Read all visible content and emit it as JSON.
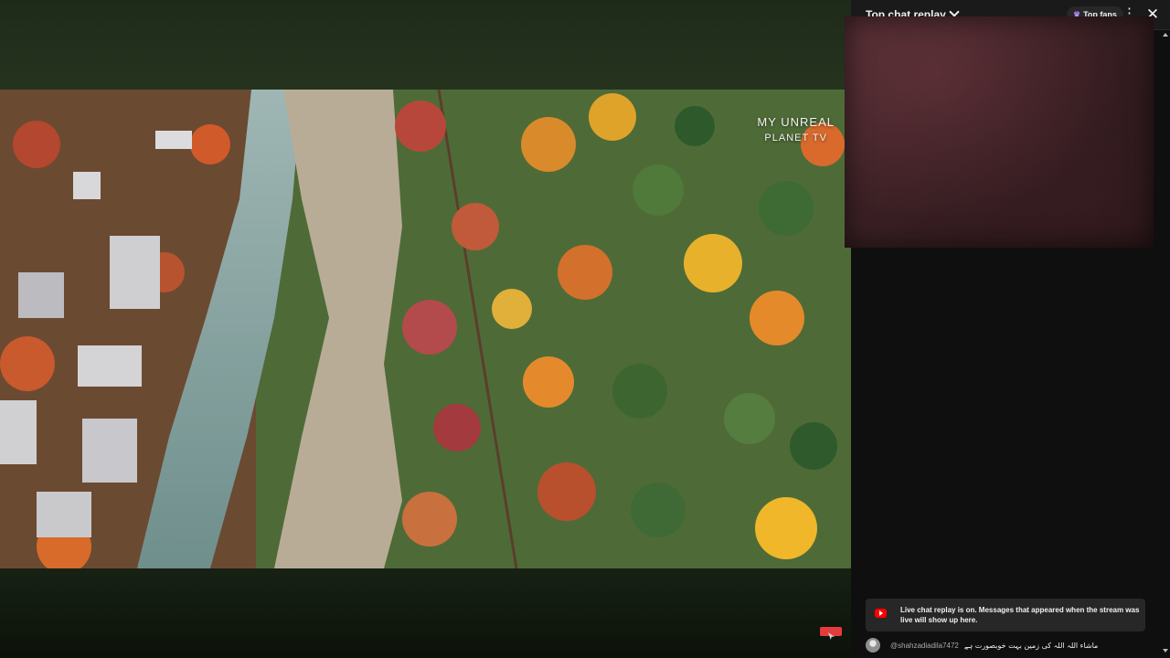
{
  "video": {
    "watermark_line1": "MY UNREAL",
    "watermark_line2": "PLANET TV"
  },
  "chat": {
    "header_title": "Top chat replay",
    "top_fans_label": "Top fans",
    "more_icon": "more-vert-icon",
    "close_icon": "close-icon",
    "replay_notice": "Live chat replay is on. Messages that appeared when the stream was live will show up here.",
    "messages": [
      {
        "author": "@shahzadiadila7472",
        "text": "ماشاء اللہ اللہ کی زمین بہت خوبصورت ہے"
      }
    ]
  },
  "colors": {
    "accent_red": "#ff0000",
    "panel_bg": "#0f0f0f",
    "banner_bg": "#272727"
  }
}
